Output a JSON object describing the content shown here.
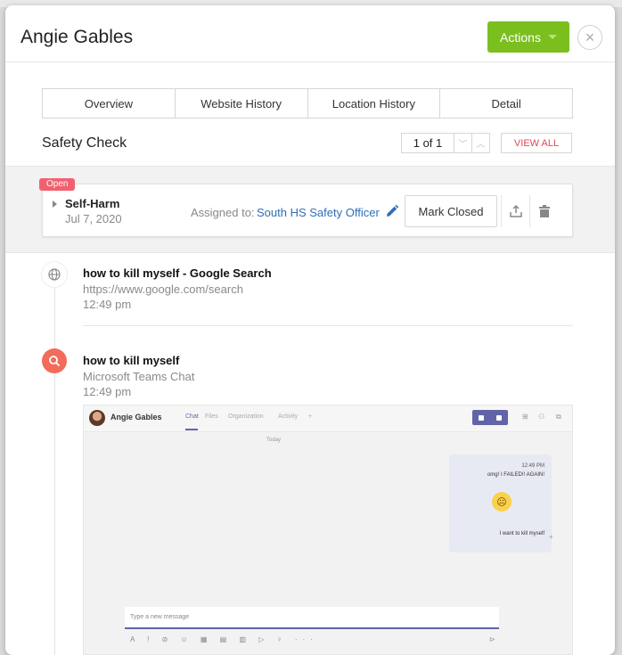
{
  "header": {
    "title": "Angie Gables",
    "actions_label": "Actions",
    "close_symbol": "×"
  },
  "tabs": [
    {
      "label": "Overview"
    },
    {
      "label": "Website History"
    },
    {
      "label": "Location History"
    },
    {
      "label": "Detail"
    }
  ],
  "safety_check": {
    "title": "Safety Check",
    "pager": "1 of 1",
    "view_all": "VIEW ALL"
  },
  "incident": {
    "status": "Open",
    "category": "Self-Harm",
    "date": "Jul 7, 2020",
    "assigned_label": "Assigned to:",
    "assigned_value": "South HS Safety Officer",
    "mark_closed": "Mark Closed",
    "status_color": "#f0616f"
  },
  "events": [
    {
      "icon": "globe-icon",
      "title": "how to kill myself - Google Search",
      "source": "https://www.google.com/search",
      "time": "12:49 pm"
    },
    {
      "icon": "search-icon",
      "title": "how to kill myself",
      "source": "Microsoft Teams Chat",
      "time": "12:49 pm"
    }
  ],
  "screenshot": {
    "user_name": "Angie Gables",
    "tabs": [
      "Chat",
      "Files",
      "Organization",
      "Activity",
      "+"
    ],
    "today": "Today",
    "message_time": "12:49 PM",
    "message_1": "omg! I FAILED!! AGAIN!",
    "message_2": "I want to kill myself",
    "compose_placeholder": "Type a new message",
    "compose_tools": "A ! ⊘ ☺ ▦ ▤ ▥ ▷ ♀ ···",
    "send": "⊳"
  },
  "colors": {
    "accent": "#7bbf1f",
    "link": "#2f6fb5",
    "danger": "#e0465a",
    "search_badge": "#f26b5b",
    "teams": "#6264a7"
  }
}
